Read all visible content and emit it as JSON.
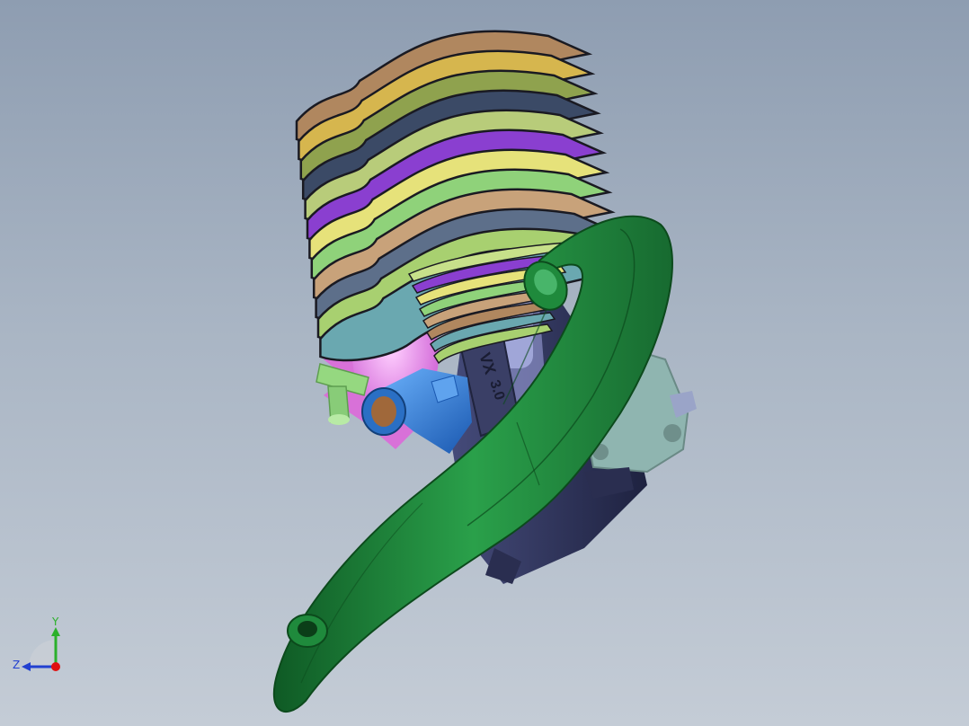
{
  "viewport": {
    "model": "rc-engine-with-tuned-pipe",
    "background_top": "#8e9db1",
    "background_bottom": "#c4ccd6"
  },
  "engine": {
    "case_markings": [
      "VX",
      "3.0"
    ],
    "colors": {
      "pipe": "#1f8a3c",
      "carburetor": "#2f7fd6",
      "backplate": "#8fb5b0",
      "crankcase": "#2c3155",
      "starter": "#e58ae6",
      "fitting": "#8fd27a"
    },
    "fin_colors": [
      "#b0875f",
      "#d6b64e",
      "#8fa24e",
      "#3b4a66",
      "#b8cc7a",
      "#8a3fd0",
      "#e6e27a",
      "#8fd27a",
      "#c8a27a",
      "#5d6f8a",
      "#a8d070",
      "#6aa8b0"
    ]
  },
  "triad": {
    "y_label": "Y",
    "z_label": "Z",
    "y_color": "#2bb02b",
    "z_color": "#2240d0",
    "x_color": "#e01010"
  }
}
